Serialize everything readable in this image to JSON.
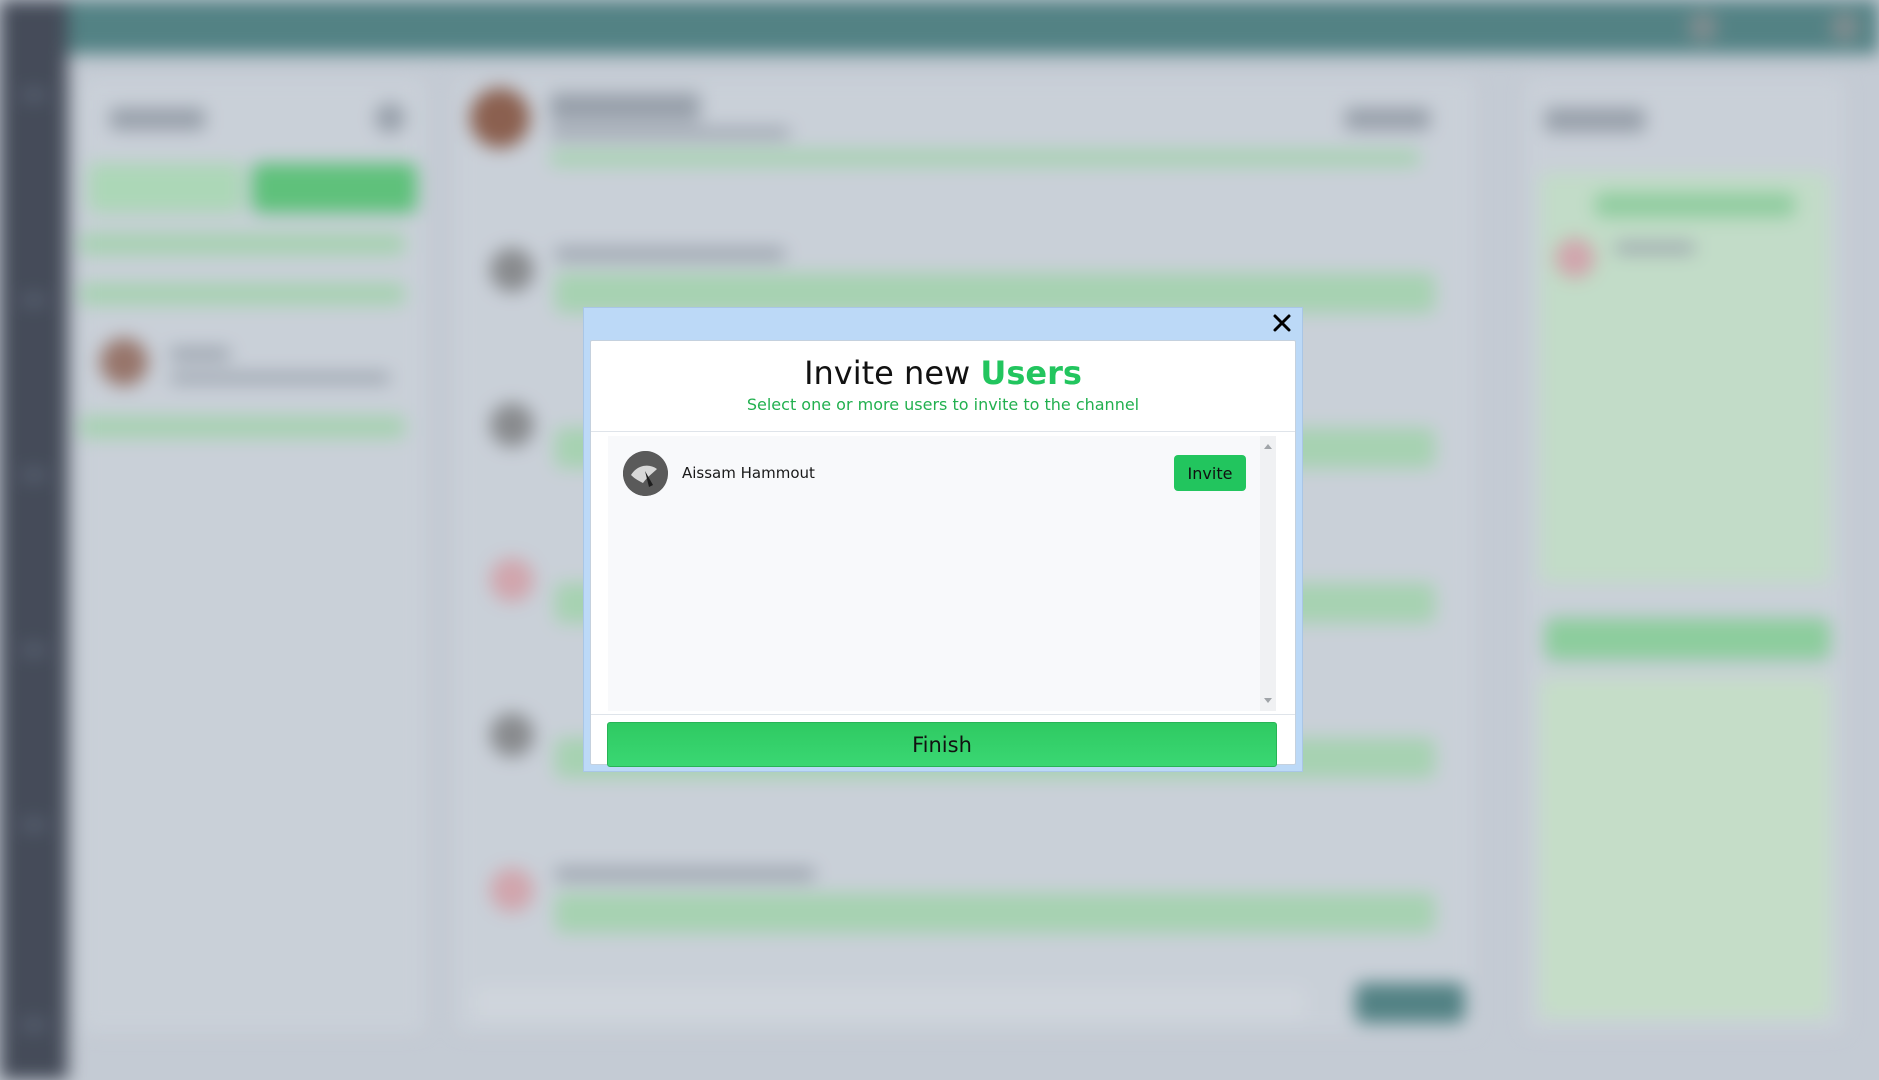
{
  "modal": {
    "title_prefix": "Invite new",
    "title_accent": "Users",
    "subtitle": "Select one or more users to invite to the channel",
    "close_icon": "close-icon",
    "users": [
      {
        "name": "Aissam Hammout",
        "invite_label": "Invite",
        "avatar_icon": "user-avatar"
      }
    ],
    "finish_label": "Finish"
  },
  "colors": {
    "accent": "#22c55e",
    "modal_frame": "#bcd9f7",
    "topbar": "#2f6b6a",
    "rail": "#1c2230"
  }
}
